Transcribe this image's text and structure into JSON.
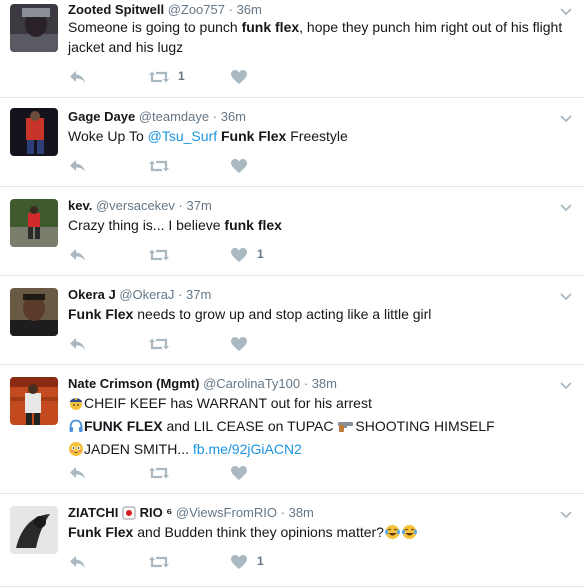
{
  "tweets": [
    {
      "name": "Zooted Spitwell",
      "handle": "@Zoo757",
      "time": "36m",
      "text": [
        "Someone is going to punch ",
        "funk flex",
        ", hope they punch him right out of his flight jacket and his lugz"
      ],
      "retweets": "1",
      "likes": ""
    },
    {
      "name": "Gage Daye",
      "handle": "@teamdaye",
      "time": "36m",
      "text": [
        "Woke Up To ",
        "@Tsu_Surf",
        " ",
        "Funk Flex",
        " Freestyle"
      ],
      "retweets": "",
      "likes": ""
    },
    {
      "name": "kev.",
      "handle": "@versacekev",
      "time": "37m",
      "text": [
        "Crazy thing is... I believe ",
        "funk flex"
      ],
      "retweets": "",
      "likes": "1"
    },
    {
      "name": "Okera J",
      "handle": "@OkeraJ",
      "time": "37m",
      "text": [
        "Funk Flex",
        " needs to grow up and stop acting like a little girl"
      ],
      "retweets": "",
      "likes": ""
    },
    {
      "name": "Nate Crimson (Mgmt)",
      "handle": "@CarolinaTy100",
      "time": "38m",
      "lines": [
        "CHEIF KEEF has WARRANT out for his arrest",
        [
          "FUNK FLEX",
          " and LIL CEASE on TUPAC ",
          "SHOOTING HIMSELF"
        ],
        [
          "JADEN SMITH... ",
          "fb.me/92jGiACN2"
        ]
      ],
      "retweets": "",
      "likes": ""
    },
    {
      "name": "ZIATCHI",
      "name_suffix": "RIO ⁶",
      "handle": "@ViewsFromRIO",
      "time": "38m",
      "text": [
        "Funk Flex",
        " and Budden think they opinions matter?"
      ],
      "retweets": "",
      "likes": "1"
    }
  ],
  "icons": {
    "reply": "reply-icon",
    "retweet": "retweet-icon",
    "like": "heart-icon",
    "more": "chevron-down-icon"
  },
  "colors": {
    "icon_gray": "#aab8c2",
    "meta_gray": "#657786",
    "link_blue": "#1b95e0",
    "divider": "#e1e8ed"
  }
}
